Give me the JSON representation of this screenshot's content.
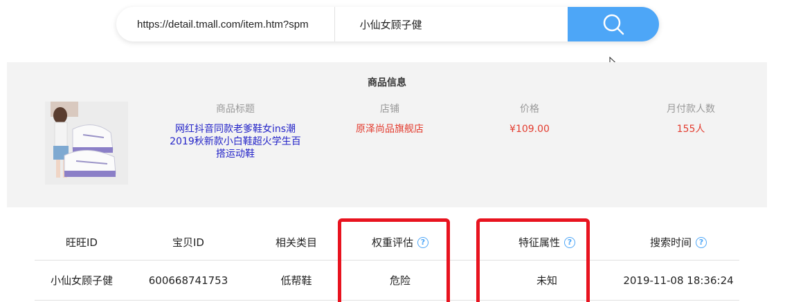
{
  "search": {
    "url_value": "https://detail.tmall.com/item.htm?spm",
    "keyword_value": "小仙女顾子健",
    "search_icon": "search-icon"
  },
  "product": {
    "section_title": "商品信息",
    "headers": {
      "title": "商品标题",
      "shop": "店铺",
      "price": "价格",
      "monthly_buyers": "月付款人数"
    },
    "title_value": "网红抖音同款老爹鞋女ins潮2019秋新款小白鞋超火学生百搭运动鞋",
    "shop_value": "原泽尚品旗舰店",
    "price_value": "¥109.00",
    "buyers_value": "155人"
  },
  "table": {
    "headers": {
      "wangwang_id": "旺旺ID",
      "item_id": "宝贝ID",
      "category": "相关类目",
      "weight_eval": "权重评估",
      "feature_attr": "特征属性",
      "search_time": "搜索时间"
    },
    "row": {
      "wangwang_id": "小仙女顾子健",
      "item_id": "600668741753",
      "category": "低帮鞋",
      "weight_eval": "危险",
      "feature_attr": "未知",
      "search_time": "2019-11-08 18:36:24"
    },
    "help_glyph": "?"
  },
  "colors": {
    "accent": "#4da6f7",
    "highlight": "#e8131f",
    "link": "#2323c8",
    "danger": "#e33b2e"
  }
}
